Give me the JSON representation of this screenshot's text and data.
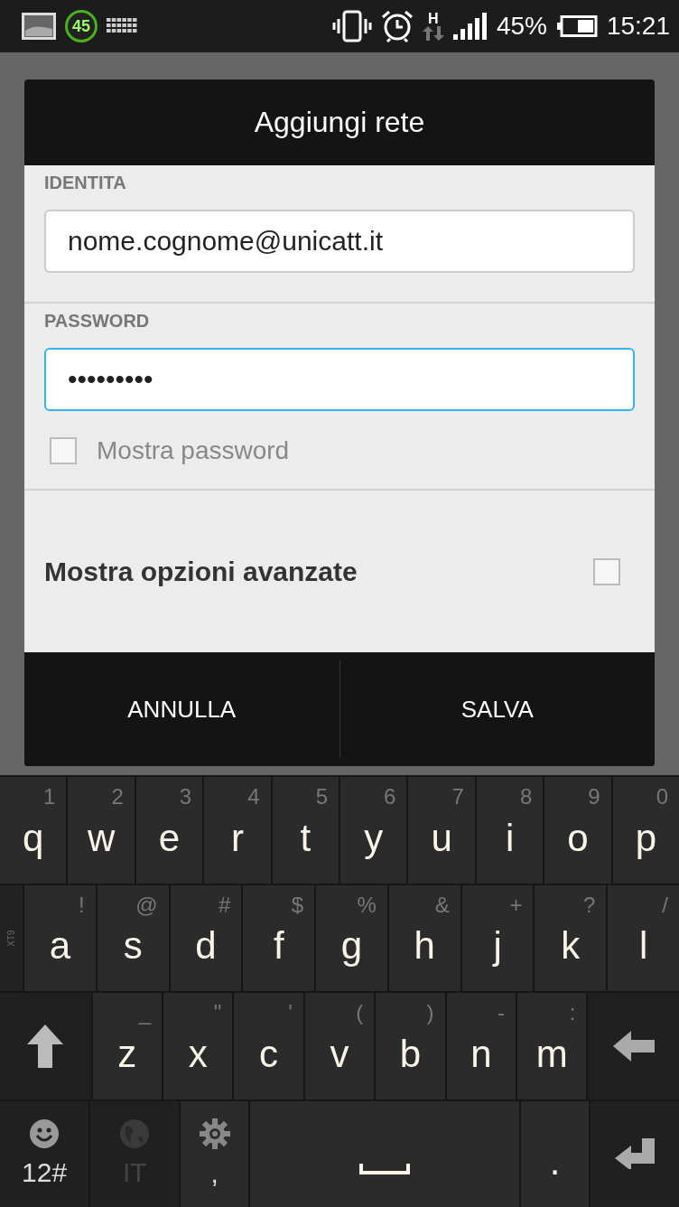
{
  "status_bar": {
    "badge": "45",
    "network_type": "H",
    "battery": "45%",
    "time": "15:21"
  },
  "dialog": {
    "title": "Aggiungi rete",
    "fields": [
      {
        "label": "IDENTITA",
        "value": "nome.cognome@unicatt.it",
        "focused": false
      },
      {
        "label": "PASSWORD",
        "value": "•••••••••",
        "focused": true
      }
    ],
    "show_password": {
      "label": "Mostra password",
      "checked": false
    },
    "advanced": {
      "label": "Mostra opzioni avanzate",
      "checked": false
    },
    "buttons": [
      "ANNULLA",
      "SALVA"
    ]
  },
  "keyboard": {
    "side_label": "XT9",
    "rows": [
      {
        "keys": [
          {
            "kind": "letter",
            "main": "q",
            "hint": "1"
          },
          {
            "kind": "letter",
            "main": "w",
            "hint": "2"
          },
          {
            "kind": "letter",
            "main": "e",
            "hint": "3"
          },
          {
            "kind": "letter",
            "main": "r",
            "hint": "4"
          },
          {
            "kind": "letter",
            "main": "t",
            "hint": "5"
          },
          {
            "kind": "letter",
            "main": "y",
            "hint": "6"
          },
          {
            "kind": "letter",
            "main": "u",
            "hint": "7"
          },
          {
            "kind": "letter",
            "main": "i",
            "hint": "8"
          },
          {
            "kind": "letter",
            "main": "o",
            "hint": "9"
          },
          {
            "kind": "letter",
            "main": "p",
            "hint": "0"
          }
        ]
      },
      {
        "keys": [
          {
            "kind": "letter",
            "main": "a",
            "hint": "!"
          },
          {
            "kind": "letter",
            "main": "s",
            "hint": "@"
          },
          {
            "kind": "letter",
            "main": "d",
            "hint": "#"
          },
          {
            "kind": "letter",
            "main": "f",
            "hint": "$"
          },
          {
            "kind": "letter",
            "main": "g",
            "hint": "%"
          },
          {
            "kind": "letter",
            "main": "h",
            "hint": "&"
          },
          {
            "kind": "letter",
            "main": "j",
            "hint": "+"
          },
          {
            "kind": "letter",
            "main": "k",
            "hint": "?"
          },
          {
            "kind": "letter",
            "main": "l",
            "hint": "/"
          }
        ]
      },
      {
        "keys": [
          {
            "kind": "shift"
          },
          {
            "kind": "letter",
            "main": "z",
            "hint": "_"
          },
          {
            "kind": "letter",
            "main": "x",
            "hint": "\""
          },
          {
            "kind": "letter",
            "main": "c",
            "hint": "'"
          },
          {
            "kind": "letter",
            "main": "v",
            "hint": "("
          },
          {
            "kind": "letter",
            "main": "b",
            "hint": ")"
          },
          {
            "kind": "letter",
            "main": "n",
            "hint": "-"
          },
          {
            "kind": "letter",
            "main": "m",
            "hint": ":"
          },
          {
            "kind": "backspace"
          }
        ]
      },
      {
        "keys": [
          {
            "kind": "emoji",
            "main": "12#",
            "disabled": false
          },
          {
            "kind": "globe",
            "main": "IT",
            "disabled": true
          },
          {
            "kind": "gear",
            "main": ",",
            "disabled": false
          },
          {
            "kind": "space"
          },
          {
            "kind": "letter",
            "main": "."
          },
          {
            "kind": "enter"
          }
        ]
      }
    ]
  }
}
